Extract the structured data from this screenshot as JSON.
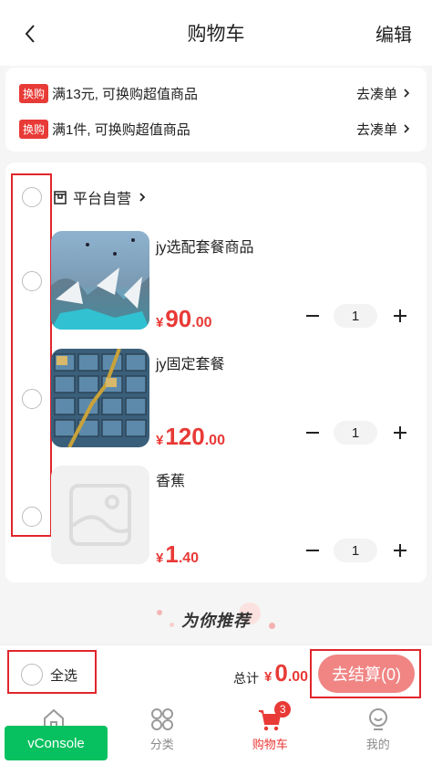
{
  "nav": {
    "title": "购物车",
    "edit": "编辑"
  },
  "promos": [
    {
      "badge": "换购",
      "text": "满13元, 可换购超值商品",
      "link": "去凑单"
    },
    {
      "badge": "换购",
      "text": "满1件, 可换购超值商品",
      "link": "去凑单"
    }
  ],
  "store": {
    "name": "平台自营"
  },
  "products": [
    {
      "name": "jy选配套餐商品",
      "currency": "¥",
      "price_int": "90",
      "price_dec": ".00",
      "qty": "1"
    },
    {
      "name": "jy固定套餐",
      "currency": "¥",
      "price_int": "120",
      "price_dec": ".00",
      "qty": "1"
    },
    {
      "name": "香蕉",
      "currency": "¥",
      "price_int": "1",
      "price_dec": ".40",
      "qty": "1"
    }
  ],
  "recommend": {
    "title": "为你推荐"
  },
  "footer": {
    "select_all": "全选",
    "total_label": "总计",
    "total_currency": "¥",
    "total_int": "0",
    "total_dec": ".00",
    "checkout": "去结算(0)"
  },
  "tabs": [
    {
      "label": "首页",
      "icon": "home-icon"
    },
    {
      "label": "分类",
      "icon": "category-icon"
    },
    {
      "label": "购物车",
      "icon": "cart-icon",
      "badge": "3",
      "active": true
    },
    {
      "label": "我的",
      "icon": "profile-icon"
    }
  ],
  "vconsole": {
    "label": "vConsole"
  },
  "colors": {
    "accent": "#e83a36",
    "checkout_bg": "#f08584",
    "vconsole_bg": "#07c160"
  }
}
